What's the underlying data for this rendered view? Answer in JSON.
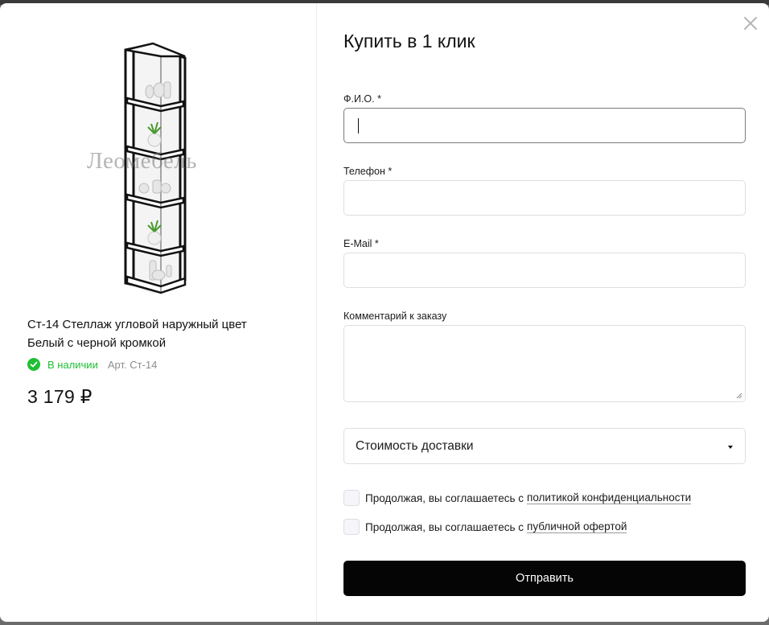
{
  "product": {
    "title": "Ст-14 Стеллаж угловой наружный цвет Белый с черной кромкой",
    "watermark": "Леомебель",
    "stock_status": "В наличии",
    "article": "Арт. Ст-14",
    "price": "3 179 ₽",
    "stock_color": "#1fbf34"
  },
  "form": {
    "title": "Купить в 1 клик",
    "fields": {
      "name_label": "Ф.И.О. *",
      "name_value": "",
      "phone_label": "Телефон *",
      "phone_value": "",
      "email_label": "E-Mail *",
      "email_value": "",
      "comment_label": "Комментарий к заказу",
      "comment_value": ""
    },
    "delivery_select": {
      "selected": "Стоимость доставки"
    },
    "consent_privacy": {
      "text": "Продолжая, вы соглашаетесь с",
      "link": "политикой конфиденциальности",
      "checked": false
    },
    "consent_offer": {
      "text": "Продолжая, вы соглашаетесь с",
      "link": "публичной офертой",
      "checked": false
    },
    "submit_label": "Отправить"
  },
  "icons": {
    "close": "close-icon",
    "stock": "check-circle-icon",
    "dropdown": "triangle-down-icon"
  }
}
